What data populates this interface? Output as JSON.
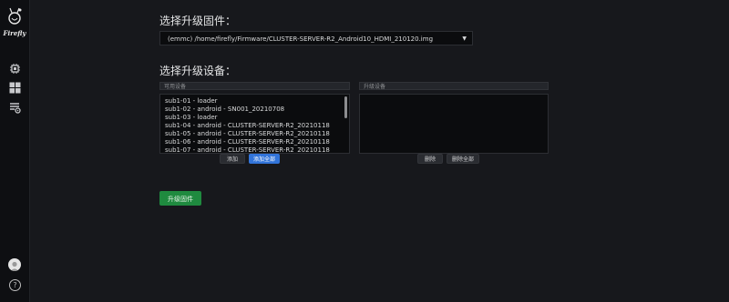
{
  "sidebar": {
    "logo_text": "Firefly",
    "icons": [
      "chip-icon",
      "dashboard-grid-icon",
      "settings-list-icon"
    ],
    "help_label": "?"
  },
  "firmware": {
    "heading": "选择升级固件：",
    "selected": "(emmc) /home/firefly/Firmware/CLUSTER-SERVER-R2_Android10_HDMI_210120.img",
    "caret": "▼"
  },
  "devices": {
    "heading": "选择升级设备：",
    "available_label": "可用设备",
    "upgrade_label": "升级设备",
    "available_items": [
      "sub1-01 - loader",
      "sub1-02 - android - SN001_20210708",
      "sub1-03 - loader",
      "sub1-04 - android - CLUSTER-SERVER-R2_20210118",
      "sub1-05 - android - CLUSTER-SERVER-R2_20210118",
      "sub1-06 - android - CLUSTER-SERVER-R2_20210118",
      "sub1-07 - android - CLUSTER-SERVER-R2_20210118"
    ],
    "upgrade_items": [],
    "add_label": "添加",
    "add_all_label": "添加全部",
    "remove_label": "删除",
    "remove_all_label": "删除全部"
  },
  "actions": {
    "upgrade_label": "升级固件"
  },
  "colors": {
    "primary": "#3274d9",
    "success": "#1f8a3f",
    "background": "#17181c"
  }
}
